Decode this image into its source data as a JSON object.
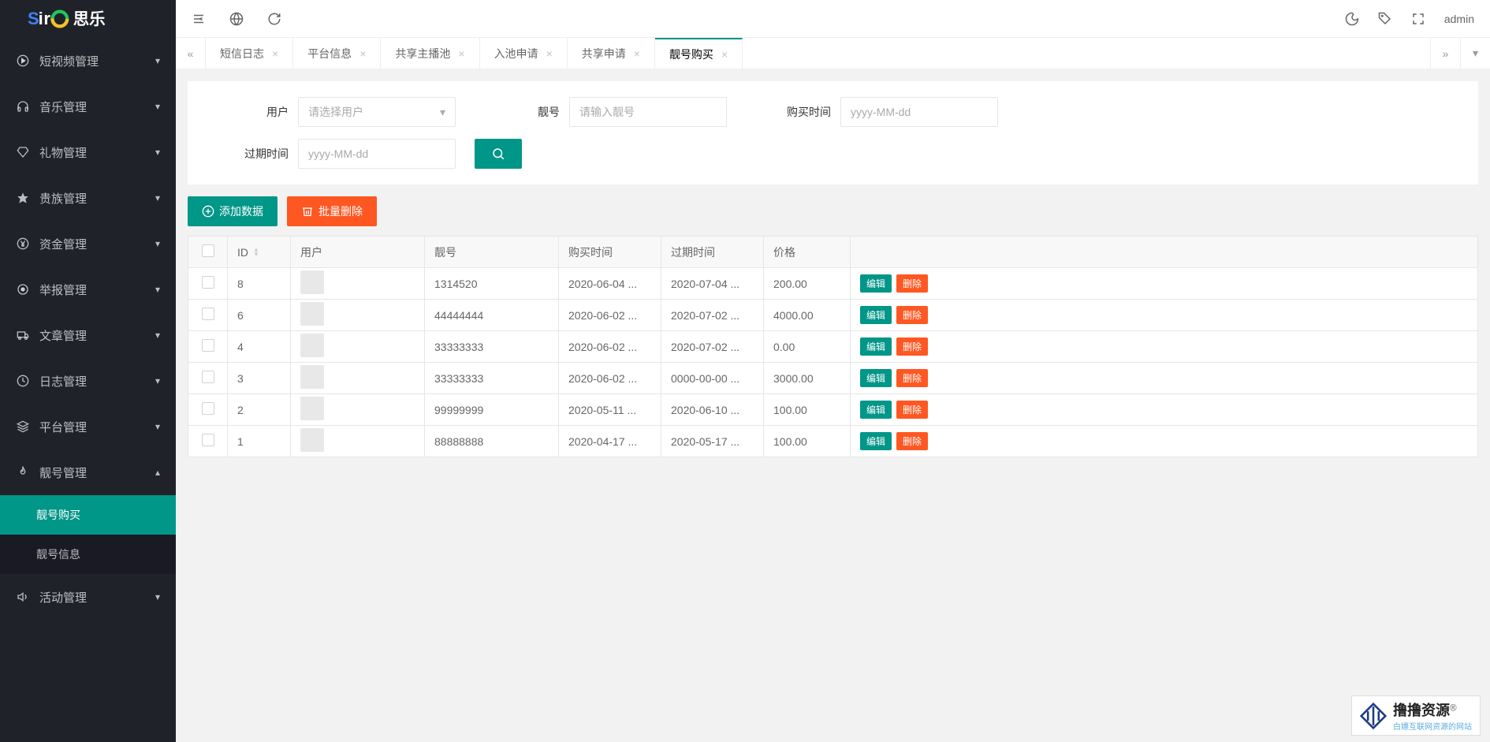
{
  "logo_text_primary": "Siro",
  "logo_text_secondary": "思乐",
  "topbar_user": "admin",
  "sidebar": {
    "items": [
      {
        "icon": "play",
        "label": "短视频管理",
        "expanded": false
      },
      {
        "icon": "headphones",
        "label": "音乐管理",
        "expanded": false
      },
      {
        "icon": "diamond",
        "label": "礼物管理",
        "expanded": false
      },
      {
        "icon": "star",
        "label": "贵族管理",
        "expanded": false
      },
      {
        "icon": "yen",
        "label": "资金管理",
        "expanded": false
      },
      {
        "icon": "dot",
        "label": "举报管理",
        "expanded": false
      },
      {
        "icon": "truck",
        "label": "文章管理",
        "expanded": false
      },
      {
        "icon": "clock",
        "label": "日志管理",
        "expanded": false
      },
      {
        "icon": "layers",
        "label": "平台管理",
        "expanded": false
      },
      {
        "icon": "flame",
        "label": "靓号管理",
        "expanded": true,
        "children": [
          {
            "label": "靓号购买",
            "active": true
          },
          {
            "label": "靓号信息",
            "active": false
          }
        ]
      },
      {
        "icon": "speaker",
        "label": "活动管理",
        "expanded": false
      }
    ]
  },
  "tabs": [
    {
      "label": "短信日志",
      "active": false
    },
    {
      "label": "平台信息",
      "active": false
    },
    {
      "label": "共享主播池",
      "active": false
    },
    {
      "label": "入池申请",
      "active": false
    },
    {
      "label": "共享申请",
      "active": false
    },
    {
      "label": "靓号购买",
      "active": true
    }
  ],
  "filter": {
    "user_label": "用户",
    "user_placeholder": "请选择用户",
    "number_label": "靓号",
    "number_placeholder": "请输入靓号",
    "buy_time_label": "购买时间",
    "buy_time_placeholder": "yyyy-MM-dd",
    "exp_time_label": "过期时间",
    "exp_time_placeholder": "yyyy-MM-dd"
  },
  "actions": {
    "add": "添加数据",
    "batch_delete": "批量删除"
  },
  "table": {
    "headers": {
      "id": "ID",
      "user": "用户",
      "number": "靓号",
      "buy_time": "购买时间",
      "exp_time": "过期时间",
      "price": "价格"
    },
    "row_actions": {
      "edit": "编辑",
      "delete": "删除"
    },
    "rows": [
      {
        "id": "8",
        "number": "1314520",
        "buy_time": "2020-06-04 ...",
        "exp_time": "2020-07-04 ...",
        "price": "200.00"
      },
      {
        "id": "6",
        "number": "44444444",
        "buy_time": "2020-06-02 ...",
        "exp_time": "2020-07-02 ...",
        "price": "4000.00"
      },
      {
        "id": "4",
        "number": "33333333",
        "buy_time": "2020-06-02 ...",
        "exp_time": "2020-07-02 ...",
        "price": "0.00"
      },
      {
        "id": "3",
        "number": "33333333",
        "buy_time": "2020-06-02 ...",
        "exp_time": "0000-00-00 ...",
        "price": "3000.00"
      },
      {
        "id": "2",
        "number": "99999999",
        "buy_time": "2020-05-11 ...",
        "exp_time": "2020-06-10 ...",
        "price": "100.00"
      },
      {
        "id": "1",
        "number": "88888888",
        "buy_time": "2020-04-17 ...",
        "exp_time": "2020-05-17 ...",
        "price": "100.00"
      }
    ]
  },
  "watermark": {
    "brand": "撸撸资源",
    "sub": "白嫖互联网资源的网站",
    "reg": "®"
  }
}
